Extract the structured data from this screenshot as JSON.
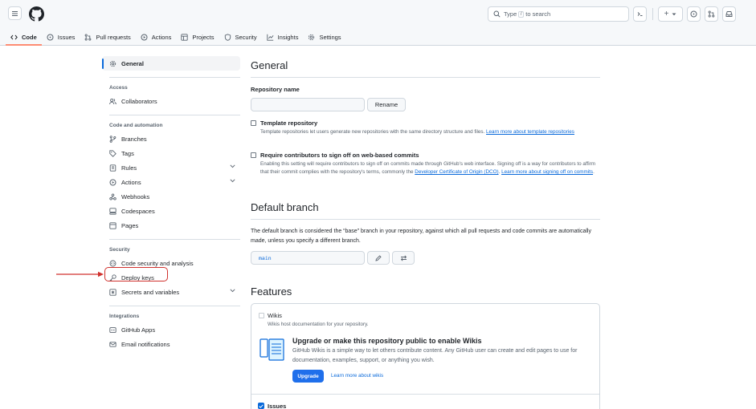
{
  "header": {
    "search_prefix": "Type",
    "search_key": "/",
    "search_suffix": "to search",
    "plus_label": "+"
  },
  "nav": {
    "tabs": [
      {
        "label": "Code",
        "icon": "code-icon"
      },
      {
        "label": "Issues",
        "icon": "issue-icon"
      },
      {
        "label": "Pull requests",
        "icon": "pull-request-icon"
      },
      {
        "label": "Actions",
        "icon": "play-icon"
      },
      {
        "label": "Projects",
        "icon": "table-icon"
      },
      {
        "label": "Security",
        "icon": "shield-icon"
      },
      {
        "label": "Insights",
        "icon": "graph-icon"
      },
      {
        "label": "Settings",
        "icon": "gear-icon"
      }
    ]
  },
  "sidebar": {
    "general": "General",
    "access_heading": "Access",
    "collaborators": "Collaborators",
    "code_heading": "Code and automation",
    "branches": "Branches",
    "tags": "Tags",
    "rules": "Rules",
    "actions": "Actions",
    "webhooks": "Webhooks",
    "codespaces": "Codespaces",
    "pages": "Pages",
    "security_heading": "Security",
    "code_security": "Code security and analysis",
    "deploy_keys": "Deploy keys",
    "secrets": "Secrets and variables",
    "integrations_heading": "Integrations",
    "github_apps": "GitHub Apps",
    "email_notifications": "Email notifications"
  },
  "general": {
    "title": "General",
    "repo_name_label": "Repository name",
    "rename_button": "Rename",
    "template_title": "Template repository",
    "template_desc": "Template repositories let users generate new repositories with the same directory structure and files.",
    "template_link": "Learn more about template repositories",
    "signoff_title": "Require contributors to sign off on web-based commits",
    "signoff_desc": "Enabling this setting will require contributors to sign off on commits made through GitHub's web interface. Signing off is a way for contributors to affirm that their commit complies with the repository's terms, commonly the",
    "signoff_link1": "Developer Certificate of Origin (DCO)",
    "signoff_link2": "Learn more about signing off on commits"
  },
  "default_branch": {
    "title": "Default branch",
    "desc": "The default branch is considered the “base” branch in your repository, against which all pull requests and code commits are automatically made, unless you specify a different branch.",
    "branch_name": "main"
  },
  "features": {
    "title": "Features",
    "wikis_title": "Wikis",
    "wikis_desc": "Wikis host documentation for your repository.",
    "promo_title": "Upgrade or make this repository public to enable Wikis",
    "promo_desc": "GitHub Wikis is a simple way to let others contribute content. Any GitHub user can create and edit pages to use for documentation, examples, support, or anything you wish.",
    "upgrade_button": "Upgrade",
    "learn_wikis": "Learn more about wikis",
    "issues_title": "Issues"
  },
  "colors": {
    "accent": "#0969da",
    "annotation": "#d0312d",
    "tab_underline": "#fd8c73"
  }
}
